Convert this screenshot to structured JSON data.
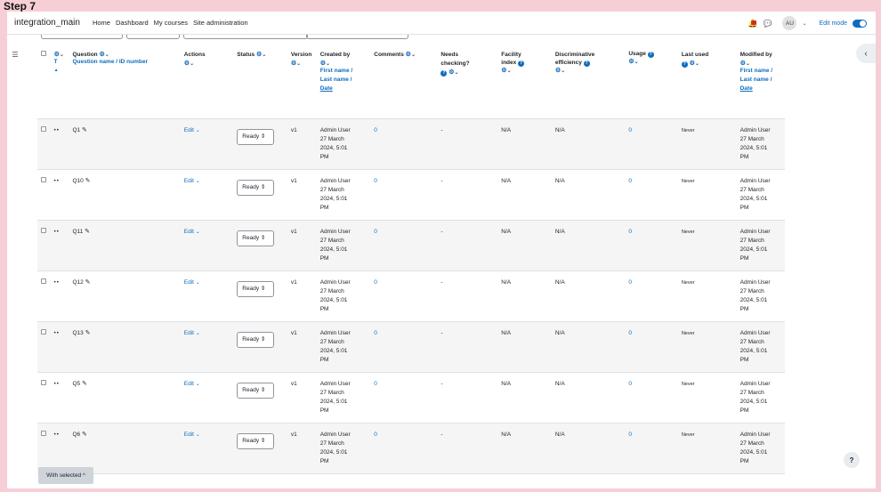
{
  "step_label": "Step 7",
  "navbar": {
    "site_name": "integration_main",
    "links": [
      "Home",
      "Dashboard",
      "My courses",
      "Site administration"
    ],
    "avatar_initials": "AU",
    "edit_mode_label": "Edit mode"
  },
  "table": {
    "headers": {
      "question": "Question",
      "question_sub1": "Question name",
      "question_sub2": "ID number",
      "t_label": "T",
      "actions": "Actions",
      "status": "Status",
      "version": "Version",
      "created_by": "Created by",
      "created_sub1": "First name",
      "created_sub2": "Last name",
      "created_sub3": "Date",
      "comments": "Comments",
      "needs_checking_1": "Needs",
      "needs_checking_2": "checking?",
      "facility_1": "Facility",
      "facility_2": "index",
      "discrim_1": "Discriminative",
      "discrim_2": "efficiency",
      "usage": "Usage",
      "last_used": "Last used",
      "modified_by": "Modified by",
      "modified_sub1": "First name",
      "modified_sub2": "Last name",
      "modified_sub3": "Date"
    },
    "rows": [
      {
        "name": "Q1",
        "edit": "Edit",
        "status": "Ready",
        "version": "v1",
        "created_name": "Admin User",
        "created_date1": "27 March",
        "created_date2": "2024, 5:01",
        "created_date3": "PM",
        "comments": "0",
        "needs": "-",
        "facility": "N/A",
        "discrim": "N/A",
        "usage": "0",
        "last_used": "Never",
        "modified_name": "Admin User",
        "modified_date1": "27 March",
        "modified_date2": "2024, 5:01",
        "modified_date3": "PM"
      },
      {
        "name": "Q10",
        "edit": "Edit",
        "status": "Ready",
        "version": "v1",
        "created_name": "Admin User",
        "created_date1": "27 March",
        "created_date2": "2024, 5:01",
        "created_date3": "PM",
        "comments": "0",
        "needs": "-",
        "facility": "N/A",
        "discrim": "N/A",
        "usage": "0",
        "last_used": "Never",
        "modified_name": "Admin User",
        "modified_date1": "27 March",
        "modified_date2": "2024, 5:01",
        "modified_date3": "PM"
      },
      {
        "name": "Q11",
        "edit": "Edit",
        "status": "Ready",
        "version": "v1",
        "created_name": "Admin User",
        "created_date1": "27 March",
        "created_date2": "2024, 5:01",
        "created_date3": "PM",
        "comments": "0",
        "needs": "-",
        "facility": "N/A",
        "discrim": "N/A",
        "usage": "0",
        "last_used": "Never",
        "modified_name": "Admin User",
        "modified_date1": "27 March",
        "modified_date2": "2024, 5:01",
        "modified_date3": "PM"
      },
      {
        "name": "Q12",
        "edit": "Edit",
        "status": "Ready",
        "version": "v1",
        "created_name": "Admin User",
        "created_date1": "27 March",
        "created_date2": "2024, 5:01",
        "created_date3": "PM",
        "comments": "0",
        "needs": "-",
        "facility": "N/A",
        "discrim": "N/A",
        "usage": "0",
        "last_used": "Never",
        "modified_name": "Admin User",
        "modified_date1": "27 March",
        "modified_date2": "2024, 5:01",
        "modified_date3": "PM"
      },
      {
        "name": "Q13",
        "edit": "Edit",
        "status": "Ready",
        "version": "v1",
        "created_name": "Admin User",
        "created_date1": "27 March",
        "created_date2": "2024, 5:01",
        "created_date3": "PM",
        "comments": "0",
        "needs": "-",
        "facility": "N/A",
        "discrim": "N/A",
        "usage": "0",
        "last_used": "Never",
        "modified_name": "Admin User",
        "modified_date1": "27 March",
        "modified_date2": "2024, 5:01",
        "modified_date3": "PM"
      },
      {
        "name": "Q5",
        "edit": "Edit",
        "status": "Ready",
        "version": "v1",
        "created_name": "Admin User",
        "created_date1": "27 March",
        "created_date2": "2024, 5:01",
        "created_date3": "PM",
        "comments": "0",
        "needs": "-",
        "facility": "N/A",
        "discrim": "N/A",
        "usage": "0",
        "last_used": "Never",
        "modified_name": "Admin User",
        "modified_date1": "27 March",
        "modified_date2": "2024, 5:01",
        "modified_date3": "PM"
      },
      {
        "name": "Q6",
        "edit": "Edit",
        "status": "Ready",
        "version": "v1",
        "created_name": "Admin User",
        "created_date1": "27 March",
        "created_date2": "2024, 5:01",
        "created_date3": "PM",
        "comments": "0",
        "needs": "-",
        "facility": "N/A",
        "discrim": "N/A",
        "usage": "0",
        "last_used": "Never",
        "modified_name": "Admin User",
        "modified_date1": "27 March",
        "modified_date2": "2024, 5:01",
        "modified_date3": "PM"
      }
    ]
  },
  "footer": {
    "with_selected": "With selected ^",
    "help_button": "?"
  },
  "icons": {
    "bell": "bell-icon",
    "chat": "chat-icon",
    "cog": "gear-icon",
    "help": "question-circle-icon",
    "pencil": "pencil-icon",
    "drag": "drag-handle-icon"
  },
  "colors": {
    "accent": "#0f6cbf",
    "page_background": "#f6cfd6"
  }
}
